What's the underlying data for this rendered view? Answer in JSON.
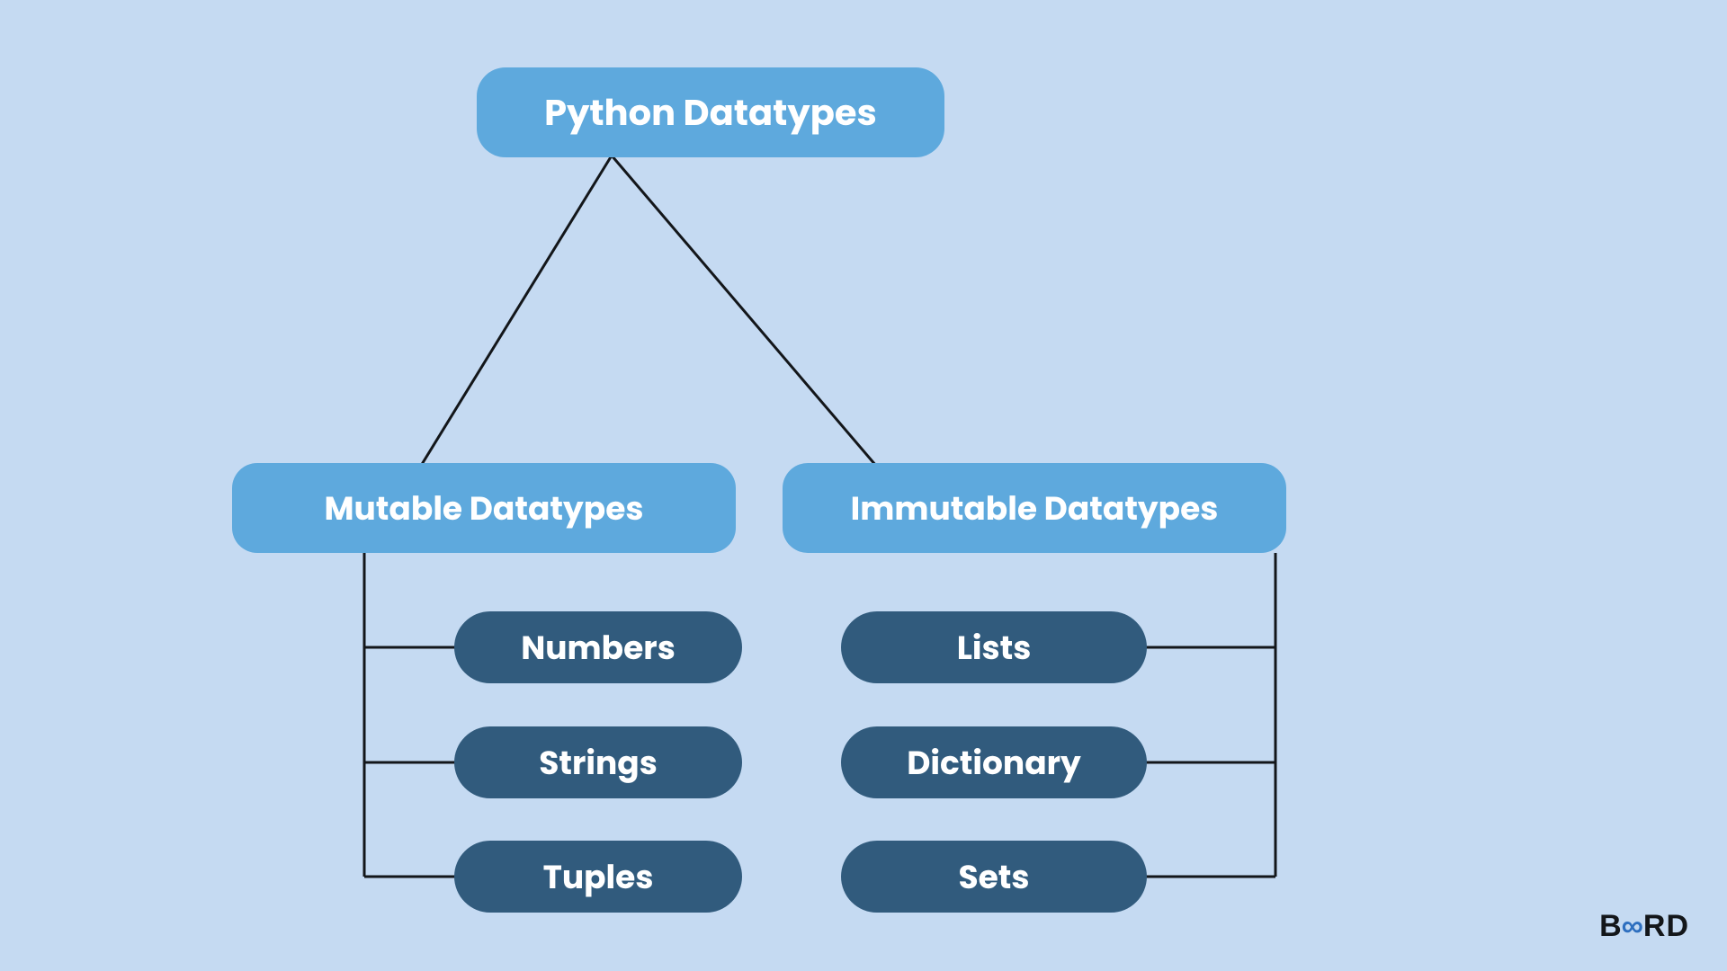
{
  "diagram": {
    "root": {
      "label": "Python Datatypes"
    },
    "categories": [
      {
        "label": "Mutable Datatypes",
        "leaves": [
          {
            "label": "Numbers"
          },
          {
            "label": "Strings"
          },
          {
            "label": "Tuples"
          }
        ]
      },
      {
        "label": "Immutable Datatypes",
        "leaves": [
          {
            "label": "Lists"
          },
          {
            "label": "Dictionary"
          },
          {
            "label": "Sets"
          }
        ]
      }
    ]
  },
  "logo": {
    "left": "B",
    "mid": "∞",
    "right": "RD"
  },
  "colors": {
    "bg": "#c5daf2",
    "light_node": "#5ea9dd",
    "dark_node": "#315b7d",
    "line": "#13161a"
  }
}
